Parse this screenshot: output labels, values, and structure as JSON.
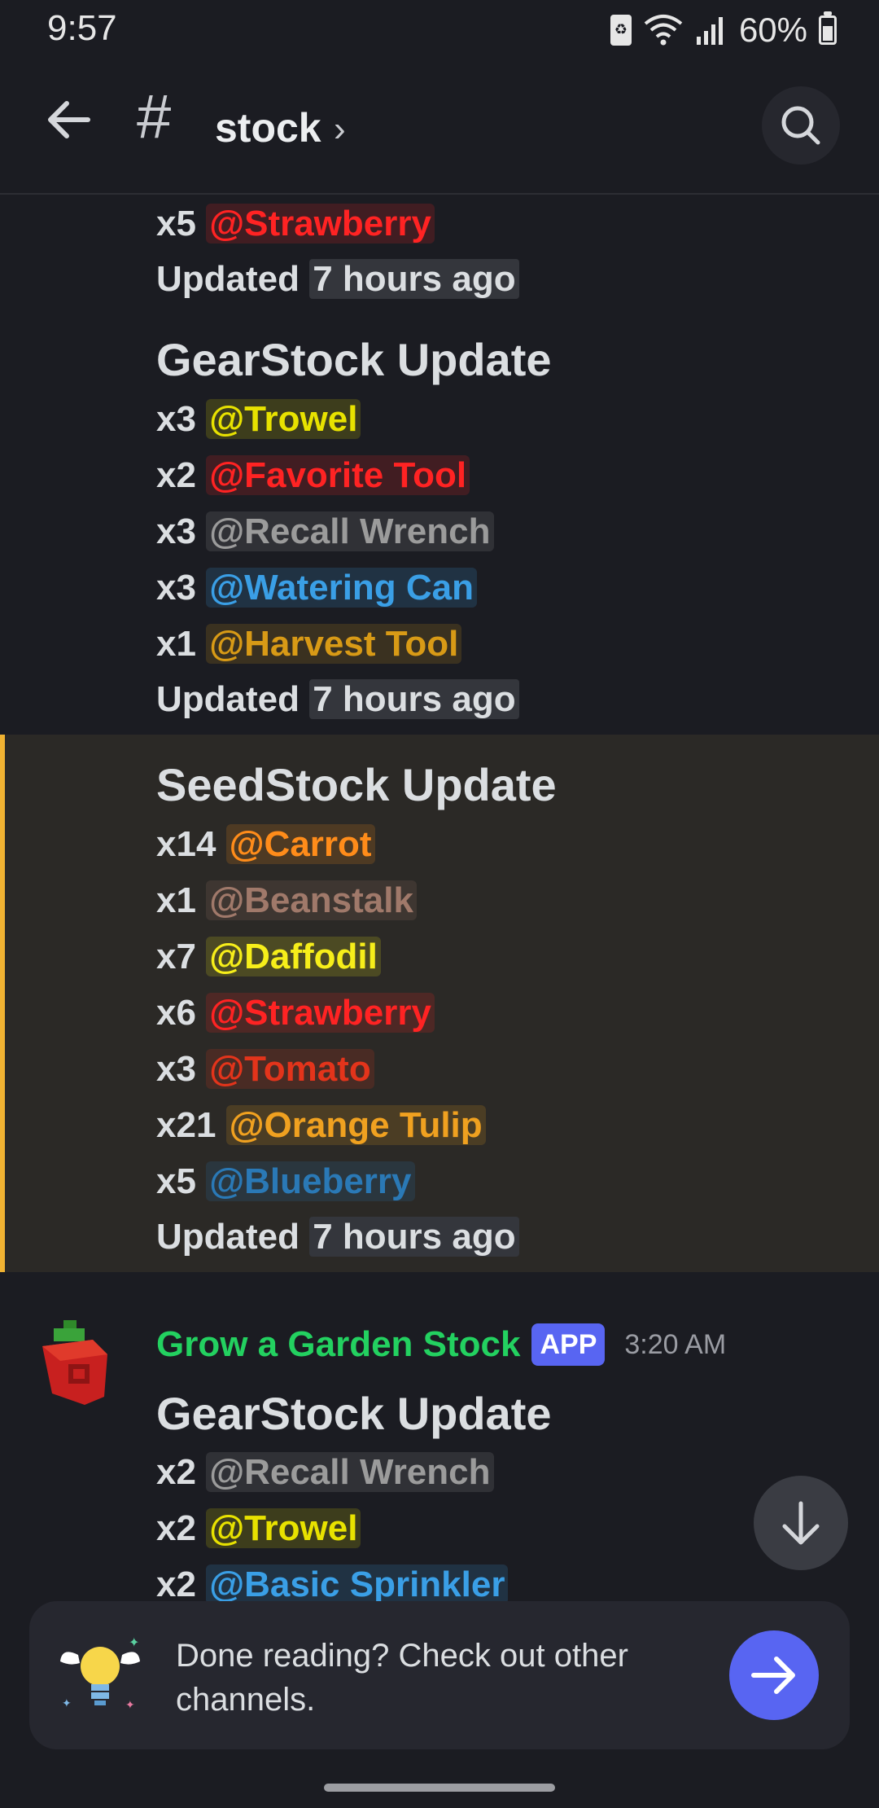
{
  "status_bar": {
    "time": "9:57",
    "battery": "60%"
  },
  "header": {
    "channel": "stock"
  },
  "feed": {
    "top_partial": {
      "qty": "x5",
      "mention": "@Strawberry"
    },
    "updated_label": "Updated",
    "updated_rel": "7 hours ago",
    "gear_block_1": {
      "title": "GearStock Update",
      "items": [
        {
          "qty": "x3",
          "name": "@Trowel"
        },
        {
          "qty": "x2",
          "name": "@Favorite Tool"
        },
        {
          "qty": "x3",
          "name": "@Recall Wrench"
        },
        {
          "qty": "x3",
          "name": "@Watering Can"
        },
        {
          "qty": "x1",
          "name": "@Harvest Tool"
        }
      ]
    },
    "seed_block": {
      "title": "SeedStock Update",
      "items": [
        {
          "qty": "x14",
          "name": "@Carrot"
        },
        {
          "qty": "x1",
          "name": "@Beanstalk"
        },
        {
          "qty": "x7",
          "name": "@Daffodil"
        },
        {
          "qty": "x6",
          "name": "@Strawberry"
        },
        {
          "qty": "x3",
          "name": "@Tomato"
        },
        {
          "qty": "x21",
          "name": "@Orange Tulip"
        },
        {
          "qty": "x5",
          "name": "@Blueberry"
        }
      ]
    },
    "message": {
      "author": "Grow a Garden Stock",
      "badge": "APP",
      "time": "3:20 AM",
      "title": "GearStock Update",
      "items": [
        {
          "qty": "x2",
          "name": "@Recall Wrench"
        },
        {
          "qty": "x2",
          "name": "@Trowel"
        },
        {
          "qty": "x2",
          "name": "@Basic Sprinkler"
        }
      ]
    }
  },
  "banner": {
    "text": "Done reading? Check out other channels."
  },
  "colors": {
    "accent": "#5865f2",
    "highlight_border": "#f0b232",
    "author": "#23d160"
  }
}
